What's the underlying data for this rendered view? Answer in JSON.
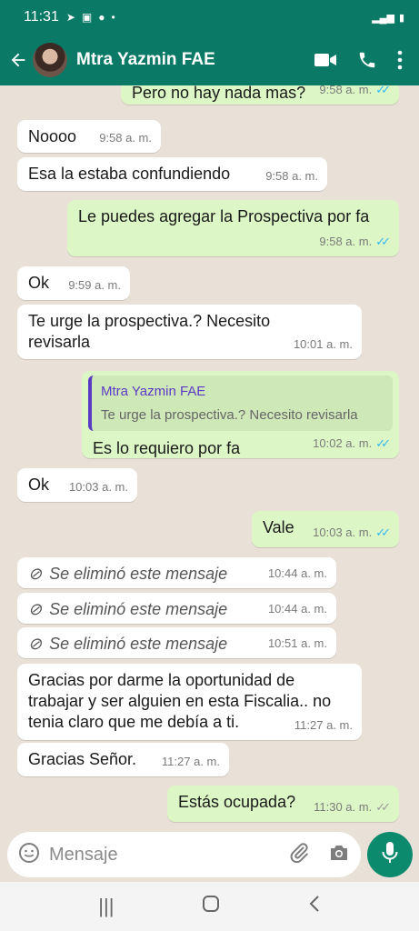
{
  "status_bar": {
    "time": "11:31",
    "right": "46 ▪"
  },
  "header": {
    "contact_name": "Mtra Yazmin FAE"
  },
  "messages": [
    {
      "text": "Pero no hay nada mas?",
      "time": "9:58 a. m."
    },
    {
      "text": "Noooo",
      "time": "9:58 a. m."
    },
    {
      "text": "Esa la estaba confundiendo",
      "time": "9:58 a. m."
    },
    {
      "text": "Le puedes agregar la Prospectiva por fa",
      "time": "9:58 a. m."
    },
    {
      "text": "Ok",
      "time": "9:59 a. m."
    },
    {
      "text": "Te urge la prospectiva.? Necesito revisarla",
      "time": "10:01 a. m."
    },
    {
      "quote_name": "Mtra Yazmin FAE",
      "quote_text": "Te urge la prospectiva.? Necesito revisarla",
      "text": "Es lo requiero por fa",
      "time": "10:02 a. m."
    },
    {
      "text": "Ok",
      "time": "10:03 a. m."
    },
    {
      "text": "Vale",
      "time": "10:03 a. m."
    },
    {
      "text": "Se eliminó este mensaje",
      "time": "10:44 a. m."
    },
    {
      "text": "Se eliminó este mensaje",
      "time": "10:44 a. m."
    },
    {
      "text": "Se eliminó este mensaje",
      "time": "10:51 a. m."
    },
    {
      "text": "Gracias por darme la oportunidad de trabajar y ser alguien en esta Fiscalia.. no tenia claro que me debía a ti.",
      "time": "11:27 a. m."
    },
    {
      "text": "Gracias Señor.",
      "time": "11:27 a. m."
    },
    {
      "text": "Estás ocupada?",
      "time": "11:30 a. m."
    }
  ],
  "input": {
    "placeholder": "Mensaje"
  },
  "colors": {
    "header": "#0a7a66",
    "incoming": "#ffffff",
    "outgoing": "#dcf7c5",
    "read_ticks": "#34b7f1",
    "quote_accent": "#5b3bc4",
    "mic_button": "#0b8a6e"
  }
}
